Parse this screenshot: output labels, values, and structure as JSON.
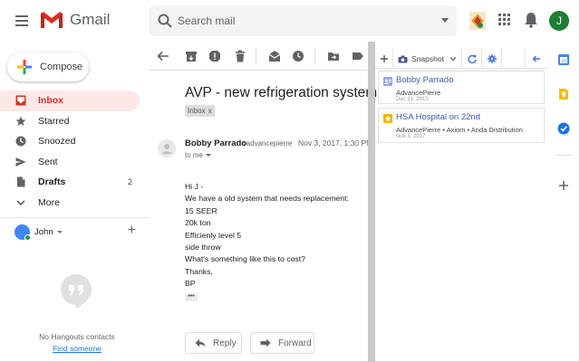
{
  "header": {
    "app_name": "Gmail",
    "search_placeholder": "Search mail",
    "account_initial": "J"
  },
  "sidebar": {
    "compose_label": "Compose",
    "items": [
      {
        "label": "Inbox",
        "icon": "inbox-icon",
        "active": true
      },
      {
        "label": "Starred",
        "icon": "star-icon"
      },
      {
        "label": "Snoozed",
        "icon": "clock-icon"
      },
      {
        "label": "Sent",
        "icon": "send-icon"
      },
      {
        "label": "Drafts",
        "icon": "draft-icon",
        "count": "2"
      },
      {
        "label": "More",
        "icon": "chevron-down-icon"
      }
    ],
    "hangouts_user": "John",
    "no_contacts": "No Hangouts contacts",
    "find_someone": "Find someone"
  },
  "email": {
    "subject": "AVP - new refrigeration system",
    "label": "Inbox",
    "sender_name": "Bobby Parrado",
    "sender_email": "<advancepierre",
    "date": "Nov 3, 2017, 1:30 PM",
    "to": "to me",
    "body": [
      "Hi J -",
      "We have a old system that needs replacement:",
      "15 SEER",
      "20k ton",
      "Efficienly level 5",
      "side throw",
      "What's something like this to cost?",
      "Thanks,",
      "BP"
    ],
    "reply_label": "Reply",
    "forward_label": "Forward"
  },
  "panel": {
    "snapshot_label": "Snapshot",
    "cards": [
      {
        "title": "Bobby Parrado",
        "subtitle": "AdvancePierre",
        "date": "Dec 21, 2015",
        "icon_color": "#9aa6e0"
      },
      {
        "title": "HSA Hospital on 22nd",
        "subtitle": "AdvancePierre • Axiom  • Anda Distribution",
        "date": "Nov 3, 2017",
        "icon_color": "#f4b400"
      }
    ]
  },
  "colors": {
    "accent_red": "#d93025",
    "link_blue": "#1a73e8",
    "avatar_green": "#1e7e34"
  }
}
